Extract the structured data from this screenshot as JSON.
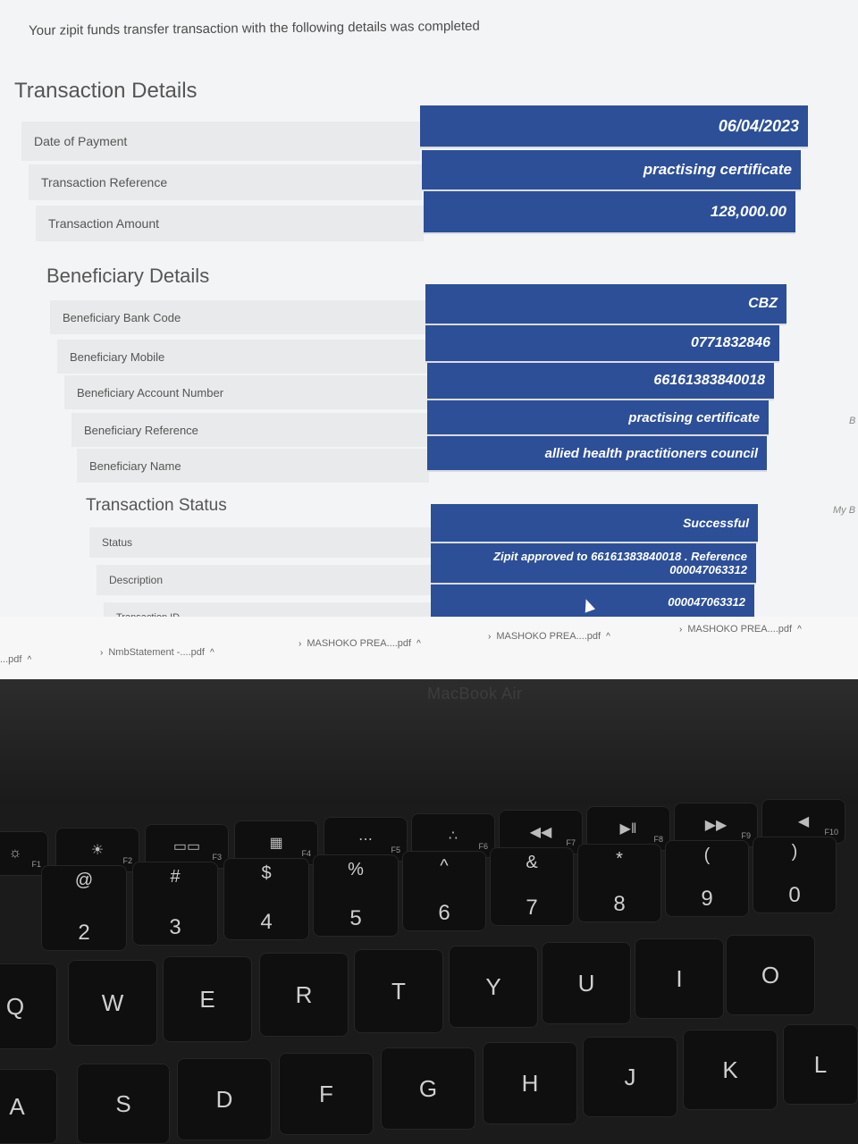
{
  "intro_text": "Your zipit funds transfer transaction with the following details was completed",
  "transaction_details": {
    "title": "Transaction Details",
    "rows": [
      {
        "label": "Date of Payment",
        "value": "06/04/2023"
      },
      {
        "label": "Transaction Reference",
        "value": "practising certificate"
      },
      {
        "label": "Transaction Amount",
        "value": "128,000.00"
      }
    ]
  },
  "beneficiary_details": {
    "title": "Beneficiary Details",
    "rows": [
      {
        "label": "Beneficiary Bank Code",
        "value": "CBZ"
      },
      {
        "label": "Beneficiary Mobile",
        "value": "0771832846"
      },
      {
        "label": "Beneficiary Account Number",
        "value": "66161383840018"
      },
      {
        "label": "Beneficiary Reference",
        "value": "practising certificate"
      },
      {
        "label": "Beneficiary Name",
        "value": "allied health practitioners council"
      }
    ]
  },
  "transaction_status": {
    "title": "Transaction Status",
    "rows": [
      {
        "label": "Status",
        "value": "Successful"
      },
      {
        "label": "Description",
        "value_line1": "Zipit approved to 66161383840018 . Reference",
        "value_line2": "000047063312"
      },
      {
        "label": "Transaction ID",
        "value": "000047063312"
      }
    ]
  },
  "side_text": {
    "b": "B",
    "my": "My B"
  },
  "downloads": [
    {
      "name": "...pdf"
    },
    {
      "name": "NmbStatement -....pdf"
    },
    {
      "name": "MASHOKO PREA....pdf"
    },
    {
      "name": "MASHOKO PREA....pdf"
    },
    {
      "name": "MASHOKO PREA....pdf"
    }
  ],
  "laptop_brand": "MacBook Air",
  "keyboard": {
    "fn_row": [
      "F1",
      "F2",
      "F3",
      "F4",
      "F5",
      "F6",
      "F7",
      "F8",
      "F9",
      "F10"
    ],
    "number_row": [
      {
        "top": "@",
        "bot": "2"
      },
      {
        "top": "#",
        "bot": "3"
      },
      {
        "top": "$",
        "bot": "4"
      },
      {
        "top": "%",
        "bot": "5"
      },
      {
        "top": "^",
        "bot": "6"
      },
      {
        "top": "&",
        "bot": "7"
      },
      {
        "top": "*",
        "bot": "8"
      },
      {
        "top": "(",
        "bot": "9"
      },
      {
        "top": ")",
        "bot": "0"
      }
    ],
    "qwerty_row": [
      "Q",
      "W",
      "E",
      "R",
      "T",
      "Y",
      "U",
      "I",
      "O"
    ],
    "asdf_row": [
      "A",
      "S",
      "D",
      "F",
      "G",
      "H",
      "J",
      "K",
      "L"
    ]
  }
}
